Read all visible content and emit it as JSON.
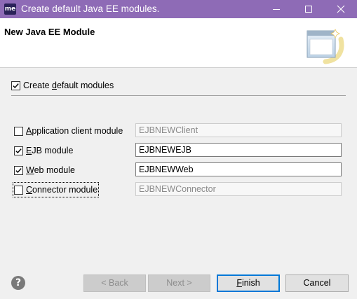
{
  "window": {
    "app_icon_text": "me",
    "title": "Create default Java EE modules.",
    "controls": {
      "minimize": "minimize-icon",
      "maximize": "maximize-icon",
      "close": "close-icon"
    },
    "titlebar_color": "#8e6bb6"
  },
  "header": {
    "title": "New Java EE Module",
    "graphic_icon": "wizard-banner-icon"
  },
  "create_default": {
    "label_before": "Create ",
    "label_mnemonic": "d",
    "label_after": "efault modules",
    "checked": true
  },
  "modules": [
    {
      "label_before": "",
      "label_mnemonic": "A",
      "label_after": "pplication client module",
      "checked": false,
      "value": "EJBNEWClient",
      "enabled": false
    },
    {
      "label_before": "",
      "label_mnemonic": "E",
      "label_after": "JB module",
      "checked": true,
      "value": "EJBNEWEJB",
      "enabled": true
    },
    {
      "label_before": "",
      "label_mnemonic": "W",
      "label_after": "eb module",
      "checked": true,
      "value": "EJBNEWWeb",
      "enabled": true
    },
    {
      "label_before": "",
      "label_mnemonic": "C",
      "label_after": "onnector module",
      "checked": false,
      "value": "EJBNEWConnector",
      "enabled": false
    }
  ],
  "footer": {
    "help_icon": "help-icon",
    "help_glyph": "?",
    "back": "< Back",
    "next": "Next >",
    "finish_mnemonic": "F",
    "finish_rest": "inish",
    "cancel": "Cancel"
  }
}
